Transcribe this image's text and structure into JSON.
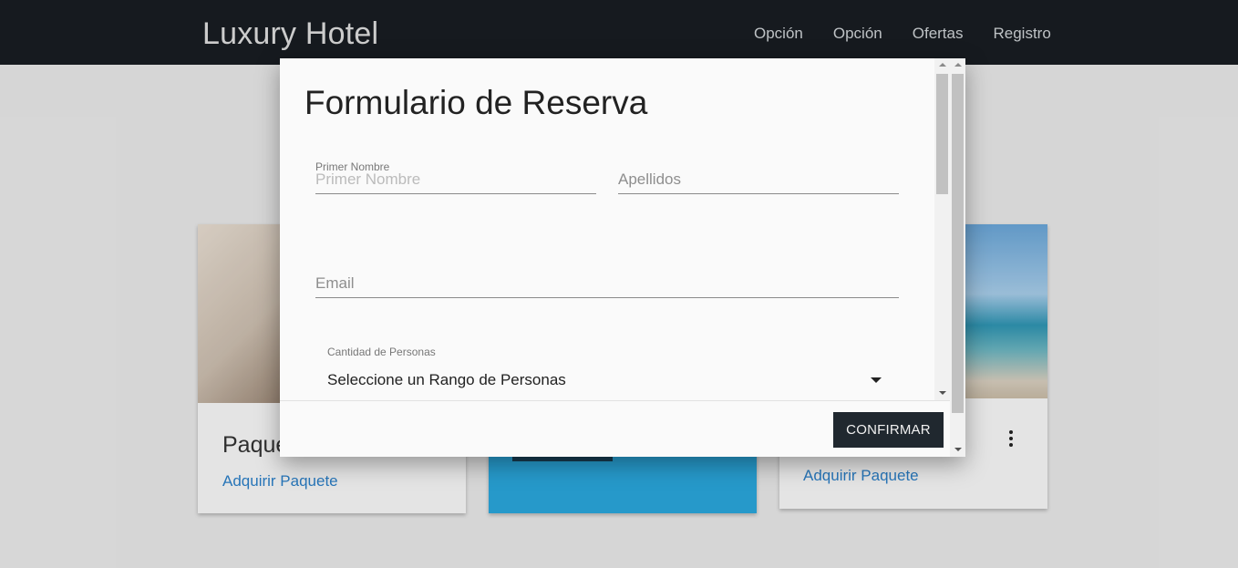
{
  "navbar": {
    "brand": "Luxury Hotel",
    "links": [
      "Opción",
      "Opción",
      "Ofertas",
      "Registro"
    ]
  },
  "cards": [
    {
      "title": "Paque",
      "link": "Adquirir Paquete"
    },
    {
      "title": "",
      "link": ""
    },
    {
      "title": "",
      "link": "Adquirir Paquete"
    }
  ],
  "modal": {
    "title": "Formulario de Reserva",
    "fields": {
      "first_name_label": "Primer Nombre",
      "first_name_placeholder": "Primer Nombre",
      "last_name_placeholder": "Apellidos",
      "email_placeholder": "Email"
    },
    "select": {
      "label": "Cantidad de Personas",
      "value": "Seleccione un Rango de Personas"
    },
    "confirm_label": "CONFIRMAR"
  }
}
